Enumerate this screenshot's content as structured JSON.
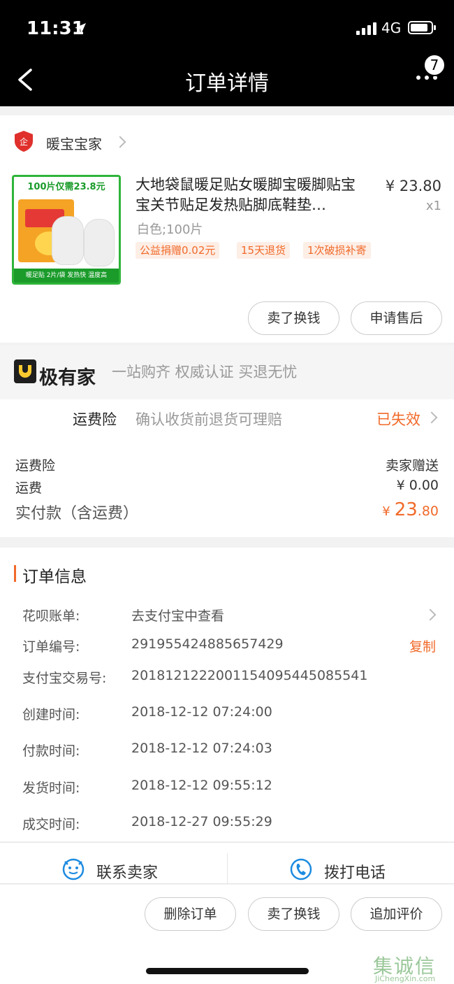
{
  "status": {
    "time": "11:31",
    "network": "4G"
  },
  "nav": {
    "title": "订单详情",
    "badge": "7"
  },
  "shop": {
    "name": "暖宝宝家"
  },
  "product": {
    "title": "大地袋鼠暖足贴女暖脚宝暖脚贴宝宝关节贴足发热贴脚底鞋垫…",
    "price": "¥ 23.80",
    "qty": "x1",
    "sku": "白色;100片",
    "tags": [
      "公益捐赠0.02元",
      "15天退货",
      "1次破损补寄"
    ],
    "image_banner": "100片仅需23.8元",
    "image_footer": "暖足贴  2片/袋   发热快 温度高"
  },
  "product_actions": {
    "sell": "卖了换钱",
    "after_sale": "申请售后"
  },
  "brand": {
    "name": "极有家",
    "slogan": "一站购齐 权威认证 买退无忧"
  },
  "insurance": {
    "label": "运费险",
    "desc": "确认收货前退货可理赔",
    "status": "已失效"
  },
  "fees": {
    "insurance_label": "运费险",
    "insurance_value": "卖家赠送",
    "shipping_label": "运费",
    "shipping_value": "¥ 0.00",
    "total_label": "实付款（含运费）",
    "total_currency": "¥",
    "total_int": "23",
    "total_dec": ".80"
  },
  "order_info": {
    "heading": "订单信息",
    "huabei_label": "花呗账单:",
    "huabei_value": "去支付宝中查看",
    "order_no_label": "订单编号:",
    "order_no": "291955424885657429",
    "copy": "复制",
    "alipay_label": "支付宝交易号:",
    "alipay_no": "2018121222001154095445085541",
    "created_label": "创建时间:",
    "created": "2018-12-12 07:24:00",
    "paid_label": "付款时间:",
    "paid": "2018-12-12 07:24:03",
    "shipped_label": "发货时间:",
    "shipped": "2018-12-12 09:55:12",
    "done_label": "成交时间:",
    "done": "2018-12-27 09:55:29"
  },
  "contact": {
    "seller": "联系卖家",
    "phone": "拨打电话"
  },
  "bottom_actions": {
    "delete": "删除订单",
    "sell": "卖了换钱",
    "review": "追加评价"
  },
  "watermark": {
    "text": "集诚信",
    "url": "JiChengXin.com"
  },
  "colors": {
    "accent": "#f16a2a",
    "blue": "#1d8be0"
  }
}
